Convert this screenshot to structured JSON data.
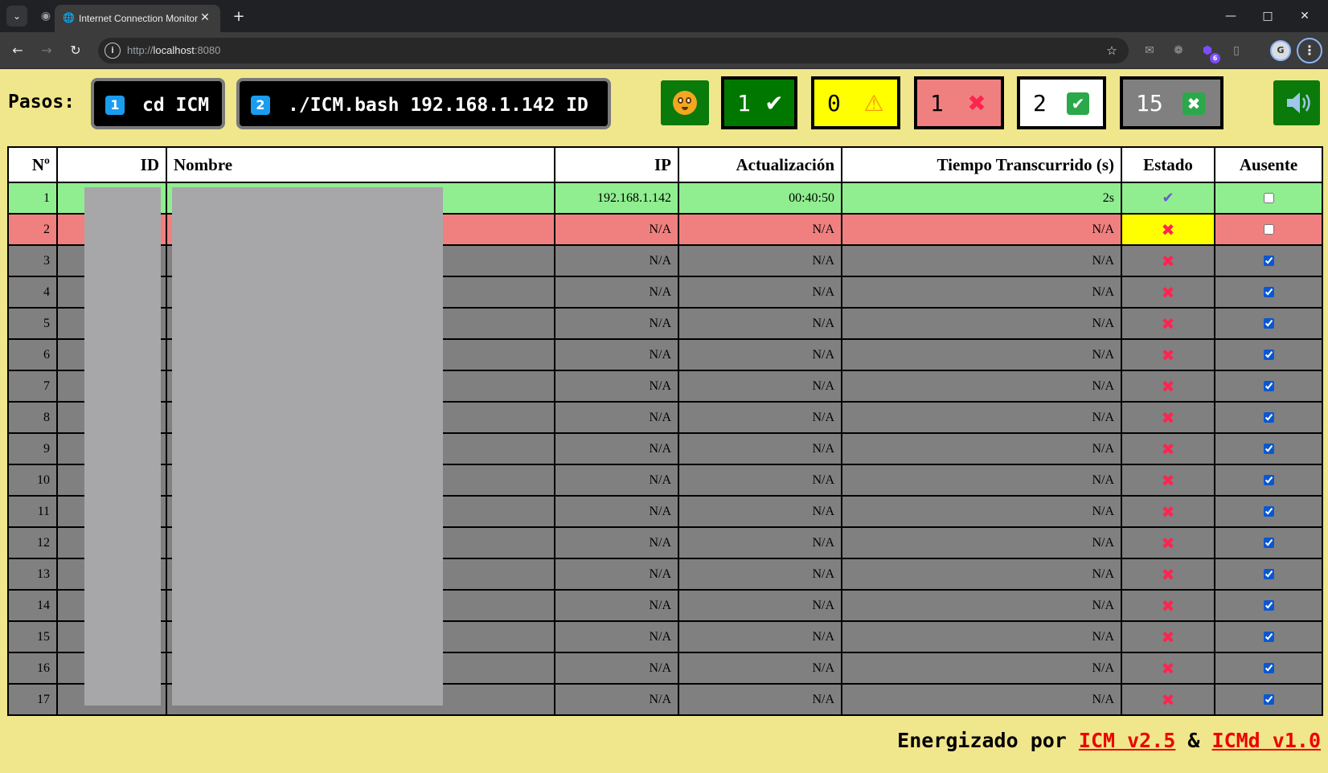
{
  "browser": {
    "tab_title": "Internet Connection Monitor",
    "url_scheme": "http://",
    "url_host": "localhost",
    "url_port": ":8080",
    "extension_badge": "6",
    "profile_initial": "G"
  },
  "header": {
    "pasos_label": "Pasos:",
    "steps": [
      {
        "num": "1",
        "cmd": "cd ICM"
      },
      {
        "num": "2",
        "cmd": "./ICM.bash 192.168.1.142 ID"
      }
    ],
    "summary": {
      "ok": {
        "count": "1",
        "bg": "#007800"
      },
      "warn": {
        "count": "0",
        "bg": "#ffff00"
      },
      "down": {
        "count": "1",
        "bg": "#f08080"
      },
      "present": {
        "count": "2",
        "bg": "#ffffff"
      },
      "absent": {
        "count": "15",
        "bg": "#808080"
      }
    }
  },
  "table": {
    "headers": {
      "num": "Nº",
      "id": "ID",
      "name": "Nombre",
      "ip": "IP",
      "update": "Actualización",
      "elapsed": "Tiempo Transcurrido (s)",
      "status": "Estado",
      "absent": "Ausente"
    },
    "rows": [
      {
        "n": "1",
        "ip": "192.168.1.142",
        "update": "00:40:50",
        "elapsed": "2s",
        "status": "online",
        "absent": false
      },
      {
        "n": "2",
        "ip": "N/A",
        "update": "N/A",
        "elapsed": "N/A",
        "status": "offline",
        "absent": false
      },
      {
        "n": "3",
        "ip": "N/A",
        "update": "N/A",
        "elapsed": "N/A",
        "status": "absent",
        "absent": true
      },
      {
        "n": "4",
        "ip": "N/A",
        "update": "N/A",
        "elapsed": "N/A",
        "status": "absent",
        "absent": true
      },
      {
        "n": "5",
        "ip": "N/A",
        "update": "N/A",
        "elapsed": "N/A",
        "status": "absent",
        "absent": true
      },
      {
        "n": "6",
        "ip": "N/A",
        "update": "N/A",
        "elapsed": "N/A",
        "status": "absent",
        "absent": true
      },
      {
        "n": "7",
        "ip": "N/A",
        "update": "N/A",
        "elapsed": "N/A",
        "status": "absent",
        "absent": true
      },
      {
        "n": "8",
        "ip": "N/A",
        "update": "N/A",
        "elapsed": "N/A",
        "status": "absent",
        "absent": true
      },
      {
        "n": "9",
        "ip": "N/A",
        "update": "N/A",
        "elapsed": "N/A",
        "status": "absent",
        "absent": true
      },
      {
        "n": "10",
        "ip": "N/A",
        "update": "N/A",
        "elapsed": "N/A",
        "status": "absent",
        "absent": true
      },
      {
        "n": "11",
        "ip": "N/A",
        "update": "N/A",
        "elapsed": "N/A",
        "status": "absent",
        "absent": true
      },
      {
        "n": "12",
        "ip": "N/A",
        "update": "N/A",
        "elapsed": "N/A",
        "status": "absent",
        "absent": true
      },
      {
        "n": "13",
        "ip": "N/A",
        "update": "N/A",
        "elapsed": "N/A",
        "status": "absent",
        "absent": true
      },
      {
        "n": "14",
        "ip": "N/A",
        "update": "N/A",
        "elapsed": "N/A",
        "status": "absent",
        "absent": true
      },
      {
        "n": "15",
        "ip": "N/A",
        "update": "N/A",
        "elapsed": "N/A",
        "status": "absent",
        "absent": true
      },
      {
        "n": "16",
        "ip": "N/A",
        "update": "N/A",
        "elapsed": "N/A",
        "status": "absent",
        "absent": true
      },
      {
        "n": "17",
        "ip": "N/A",
        "update": "N/A",
        "elapsed": "N/A",
        "status": "absent",
        "absent": true
      }
    ]
  },
  "footer": {
    "prefix": "Energizado por",
    "link1": "ICM v2.5",
    "amp": "&",
    "link2": "ICMd v1.0"
  },
  "colors": {
    "page_bg": "#f0e68c",
    "online_row": "#90ee90",
    "offline_row": "#f08080",
    "absent_row": "#808080",
    "warn_cell": "#ffff00",
    "link": "#ee0000"
  }
}
